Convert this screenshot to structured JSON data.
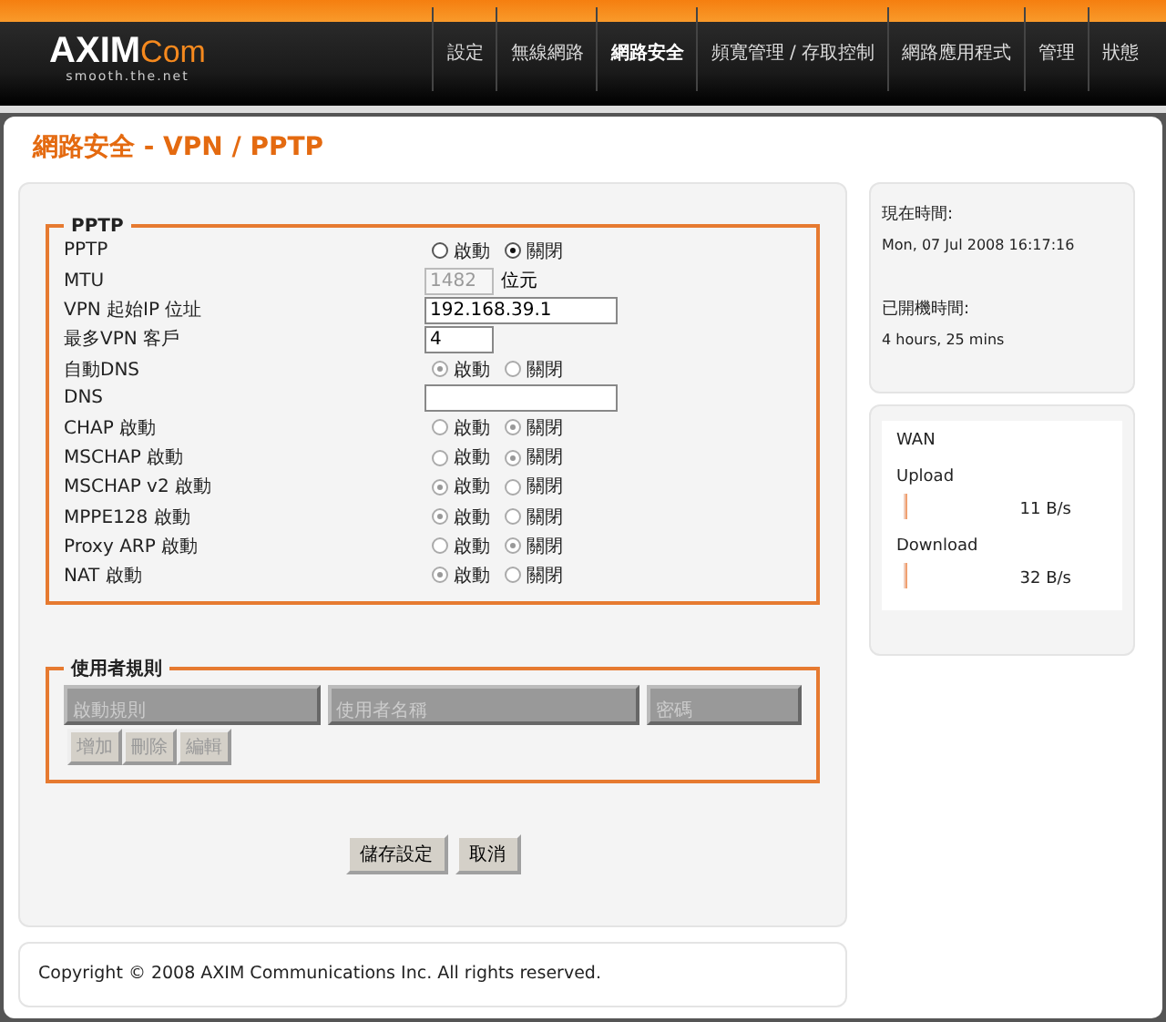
{
  "logo": {
    "brand": "AXIM",
    "suffix": "Com",
    "tagline": "smooth.the.net"
  },
  "nav": [
    {
      "label": "設定",
      "selected": false
    },
    {
      "label": "無線網路",
      "selected": false
    },
    {
      "label": "網路安全",
      "selected": true
    },
    {
      "label": "頻寬管理 / 存取控制",
      "selected": false
    },
    {
      "label": "網路應用程式",
      "selected": false
    },
    {
      "label": "管理",
      "selected": false
    },
    {
      "label": "狀態",
      "selected": false
    }
  ],
  "page_title": "網路安全 - VPN / PPTP",
  "pptp": {
    "legend": "PPTP",
    "rows": [
      {
        "kind": "radio",
        "label": "PPTP",
        "disabled": false,
        "options": [
          {
            "label": "啟動",
            "selected": false
          },
          {
            "label": "關閉",
            "selected": true
          }
        ]
      },
      {
        "kind": "short_field",
        "label": "MTU",
        "value": "1482",
        "disabled": true,
        "unit": "位元"
      },
      {
        "kind": "field",
        "label": "VPN 起始IP 位址",
        "value": "192.168.39.1",
        "disabled": false
      },
      {
        "kind": "short_field",
        "label": "最多VPN 客戶",
        "value": "4",
        "disabled": false
      },
      {
        "kind": "radio",
        "label": "自動DNS",
        "disabled": true,
        "options": [
          {
            "label": "啟動",
            "selected": true
          },
          {
            "label": "關閉",
            "selected": false
          }
        ]
      },
      {
        "kind": "field",
        "label": "DNS",
        "value": "",
        "disabled": false
      },
      {
        "kind": "radio",
        "label": "CHAP 啟動",
        "disabled": true,
        "options": [
          {
            "label": "啟動",
            "selected": false
          },
          {
            "label": "關閉",
            "selected": true
          }
        ]
      },
      {
        "kind": "radio",
        "label": "MSCHAP 啟動",
        "disabled": true,
        "options": [
          {
            "label": "啟動",
            "selected": false
          },
          {
            "label": "關閉",
            "selected": true
          }
        ]
      },
      {
        "kind": "radio",
        "label": "MSCHAP v2 啟動",
        "disabled": true,
        "options": [
          {
            "label": "啟動",
            "selected": true
          },
          {
            "label": "關閉",
            "selected": false
          }
        ]
      },
      {
        "kind": "radio",
        "label": "MPPE128 啟動",
        "disabled": true,
        "options": [
          {
            "label": "啟動",
            "selected": true
          },
          {
            "label": "關閉",
            "selected": false
          }
        ]
      },
      {
        "kind": "radio",
        "label": "Proxy ARP 啟動",
        "disabled": true,
        "options": [
          {
            "label": "啟動",
            "selected": false
          },
          {
            "label": "關閉",
            "selected": true
          }
        ]
      },
      {
        "kind": "radio",
        "label": "NAT 啟動",
        "disabled": true,
        "options": [
          {
            "label": "啟動",
            "selected": true
          },
          {
            "label": "關閉",
            "selected": false
          }
        ]
      }
    ]
  },
  "user_rules": {
    "legend": "使用者規則",
    "columns": [
      "啟動規則",
      "使用者名稱",
      "密碼"
    ],
    "actions": [
      "增加",
      "刪除",
      "編輯"
    ]
  },
  "buttons": [
    "儲存設定",
    "取消"
  ],
  "footer": "Copyright © 2008 AXIM Communications Inc. All rights reserved.",
  "status": {
    "time_label": "現在時間:",
    "time": "Mon, 07 Jul 2008 16:17:16",
    "uptime_label": "已開機時間:",
    "uptime": "4 hours, 25 mins"
  },
  "wan": {
    "title": "WAN",
    "meters": [
      {
        "label": "Upload",
        "level": 0.01,
        "reading": "11 B/s"
      },
      {
        "label": "Download",
        "level": 0.01,
        "reading": "32 B/s"
      }
    ]
  }
}
